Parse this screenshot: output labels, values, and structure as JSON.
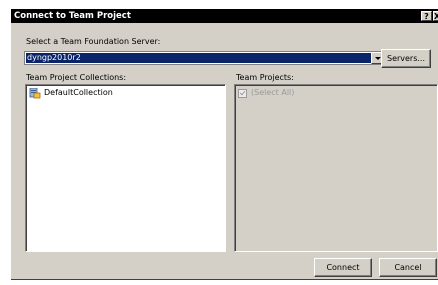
{
  "dialog": {
    "title": "Connect to Team Project",
    "help_label": "?",
    "close_label": "X"
  },
  "server": {
    "label": "Select a Team Foundation Server:",
    "selected": "dyngp2010r2",
    "servers_button": "Servers..."
  },
  "collections": {
    "label": "Team Project Collections:",
    "items": [
      "DefaultCollection"
    ]
  },
  "projects": {
    "label": "Team Projects:",
    "select_all": "(Select All)"
  },
  "footer": {
    "connect_label": "Connect",
    "cancel_label": "Cancel"
  },
  "colors": {
    "title_bar": "#000000",
    "dialog_bg": "#d4d0c8",
    "selection": "#0a246a"
  }
}
